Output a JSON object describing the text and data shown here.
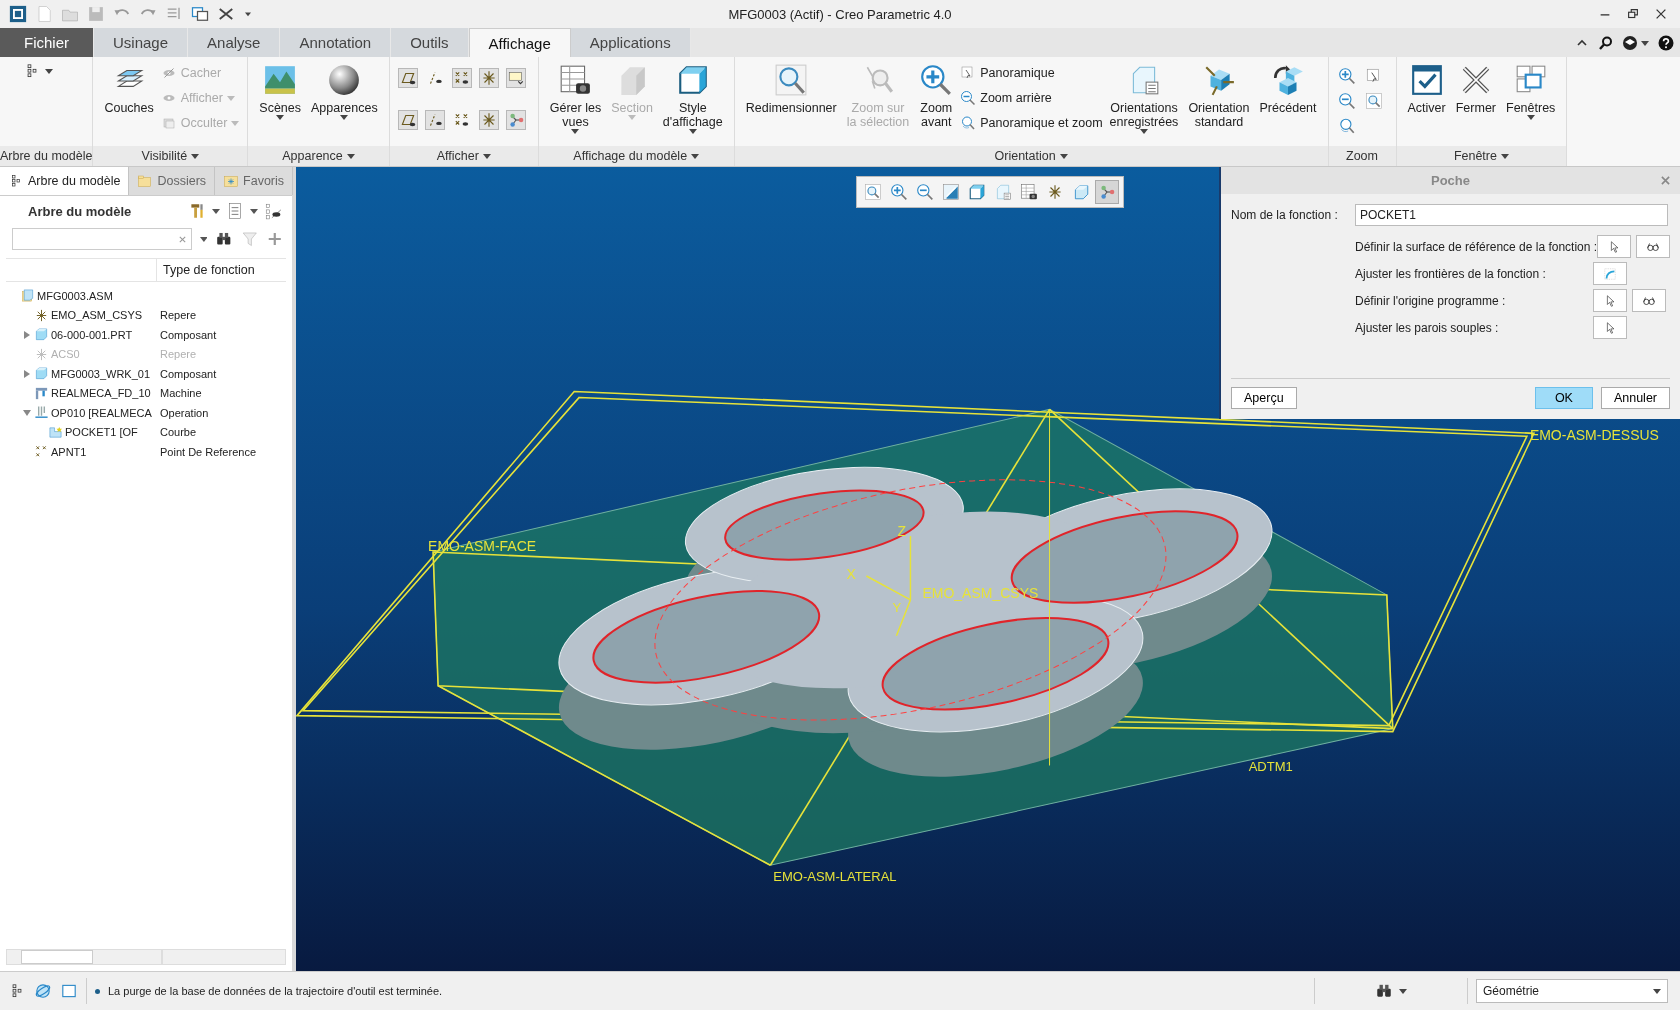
{
  "window": {
    "title": "MFG0003 (Actif) - Creo Parametric 4.0"
  },
  "tabs": [
    {
      "label": "Fichier",
      "kind": "file",
      "selected": false
    },
    {
      "label": "Usinage",
      "kind": "tab",
      "selected": false
    },
    {
      "label": "Analyse",
      "kind": "tab",
      "selected": false
    },
    {
      "label": "Annotation",
      "kind": "tab",
      "selected": false
    },
    {
      "label": "Outils",
      "kind": "tab",
      "selected": false
    },
    {
      "label": "Affichage",
      "kind": "tab",
      "selected": true
    },
    {
      "label": "Applications",
      "kind": "tab",
      "selected": false
    }
  ],
  "ribbon_groups": [
    {
      "label": "Arbre du modèle",
      "menu": false,
      "commands": [
        {
          "kind": "icon",
          "menu": true,
          "on": false
        }
      ]
    },
    {
      "label": "Visibilité",
      "menu": true,
      "commands": [
        {
          "kind": "large",
          "label": "Couches",
          "disabled": false,
          "menu": false
        },
        {
          "kind": "small",
          "label": "Cacher",
          "disabled": true,
          "menu": false
        },
        {
          "kind": "small",
          "label": "Afficher",
          "disabled": true,
          "menu": true
        },
        {
          "kind": "small",
          "label": "Occulter",
          "disabled": true,
          "menu": true
        }
      ]
    },
    {
      "label": "Apparence",
      "menu": true,
      "commands": [
        {
          "kind": "large",
          "label": "Scènes",
          "disabled": false,
          "menu": true
        },
        {
          "kind": "large",
          "label": "Apparences",
          "disabled": false,
          "menu": true
        }
      ]
    },
    {
      "label": "Afficher",
      "menu": true,
      "commands": [
        {
          "kind": "icon",
          "menu": false,
          "on": true
        },
        {
          "kind": "icon",
          "menu": false,
          "on": false
        },
        {
          "kind": "icon",
          "menu": false,
          "on": true
        },
        {
          "kind": "icon",
          "menu": false,
          "on": true
        },
        {
          "kind": "icon",
          "menu": false,
          "on": true
        },
        {
          "kind": "icon",
          "menu": false,
          "on": true
        },
        {
          "kind": "icon",
          "menu": false,
          "on": true
        },
        {
          "kind": "icon",
          "menu": false,
          "on": false
        },
        {
          "kind": "icon",
          "menu": false,
          "on": true
        },
        {
          "kind": "icon",
          "menu": false,
          "on": true
        }
      ]
    },
    {
      "label": "Affichage du modèle",
      "menu": true,
      "commands": [
        {
          "kind": "large",
          "label": "Gérer les\nvues",
          "disabled": false,
          "menu": true
        },
        {
          "kind": "large",
          "label": "Section",
          "disabled": true,
          "menu": true
        },
        {
          "kind": "large",
          "label": "Style\nd'affichage",
          "disabled": false,
          "menu": true
        }
      ]
    },
    {
      "label": "Orientation",
      "menu": true,
      "commands": [
        {
          "kind": "large",
          "label": "Redimensionner",
          "disabled": false,
          "menu": false
        },
        {
          "kind": "large",
          "label": "Zoom sur\nla sélection",
          "disabled": true,
          "menu": false
        },
        {
          "kind": "large",
          "label": "Zoom\navant",
          "disabled": false,
          "menu": false
        },
        {
          "kind": "small",
          "label": "Panoramique",
          "disabled": false,
          "menu": false
        },
        {
          "kind": "small",
          "label": "Zoom arrière",
          "disabled": false,
          "menu": false
        },
        {
          "kind": "small",
          "label": "Panoramique et zoom",
          "disabled": false,
          "menu": false
        },
        {
          "kind": "large",
          "label": "Orientations\nenregistrées",
          "disabled": false,
          "menu": true
        },
        {
          "kind": "large",
          "label": "Orientation\nstandard",
          "disabled": false,
          "menu": false
        },
        {
          "kind": "large",
          "label": "Précédent",
          "disabled": false,
          "menu": false
        }
      ]
    },
    {
      "label": "Zoom",
      "menu": false,
      "commands": [
        {
          "kind": "icon",
          "menu": false,
          "on": false
        },
        {
          "kind": "icon",
          "menu": false,
          "on": false
        },
        {
          "kind": "icon",
          "menu": false,
          "on": false
        },
        {
          "kind": "icon",
          "menu": false,
          "on": false
        },
        {
          "kind": "icon",
          "menu": false,
          "on": false
        }
      ]
    },
    {
      "label": "Fenêtre",
      "menu": true,
      "commands": [
        {
          "kind": "large",
          "label": "Activer",
          "disabled": false,
          "menu": false
        },
        {
          "kind": "large",
          "label": "Fermer",
          "disabled": false,
          "menu": false
        },
        {
          "kind": "large",
          "label": "Fenêtres",
          "disabled": false,
          "menu": true
        }
      ]
    }
  ],
  "panel": {
    "tabs": [
      {
        "label": "Arbre du modèle",
        "selected": true
      },
      {
        "label": "Dossiers",
        "selected": false
      },
      {
        "label": "Favoris",
        "selected": false
      }
    ],
    "heading": "Arbre du modèle",
    "column_header": "Type de fonction",
    "tree": [
      {
        "name": "MFG0003.ASM",
        "disabled": false,
        "children": [
          {
            "name": "EMO_ASM_CSYS",
            "type": "Repere",
            "disabled": false
          },
          {
            "name": "06-000-001.PRT",
            "type": "Composant",
            "disabled": false,
            "expanded": false
          },
          {
            "name": "ACS0",
            "type": "Repere",
            "disabled": true
          },
          {
            "name": "MFG0003_WRK_01",
            "type": "Composant",
            "disabled": false,
            "expanded": false
          },
          {
            "name": "REALMECA_FD_10",
            "type": "Machine",
            "disabled": false
          },
          {
            "name": "OP010 [REALMECA",
            "type": "Operation",
            "disabled": false,
            "expanded": true,
            "children": [
              {
                "name": "POCKET1 [OF",
                "type": "Courbe",
                "disabled": false
              }
            ]
          },
          {
            "name": "APNT1",
            "type": "Point De Reference",
            "disabled": false
          }
        ]
      }
    ]
  },
  "view_toolbar": [
    {
      "on": false
    },
    {
      "on": false
    },
    {
      "on": false
    },
    {
      "on": false
    },
    {
      "on": false
    },
    {
      "on": false
    },
    {
      "on": false
    },
    {
      "on": false
    },
    {
      "on": false
    },
    {
      "on": true
    }
  ],
  "datum_labels": [
    {
      "text": "EMO-ASM-DESSUS"
    },
    {
      "text": "EMO-ASM-FACE"
    },
    {
      "text": "Z"
    },
    {
      "text": "X"
    },
    {
      "text": "EMO_ASM_CSYS"
    },
    {
      "text": "Y"
    },
    {
      "text": "ADTM1"
    },
    {
      "text": "EMO-ASM-LATERAL"
    }
  ],
  "dialog": {
    "title": "Poche",
    "name_label": "Nom de la fonction :",
    "name_value": "POCKET1",
    "rows": [
      {
        "label": "Définir la surface de référence de la fonction :",
        "buttons": [
          {
            "kind": "select"
          },
          {
            "kind": "show"
          }
        ]
      },
      {
        "label": "Ajuster les frontières de la fonction :",
        "buttons": [
          {
            "kind": "boundary"
          }
        ]
      },
      {
        "label": "Définir l'origine programme :",
        "buttons": [
          {
            "kind": "select"
          },
          {
            "kind": "show"
          }
        ]
      },
      {
        "label": "Ajuster les parois souples :",
        "buttons": [
          {
            "kind": "select"
          }
        ]
      }
    ],
    "buttons": [
      {
        "label": "Aperçu",
        "kind": "secondary"
      },
      {
        "label": "OK",
        "kind": "primary"
      },
      {
        "label": "Annuler",
        "kind": "secondary"
      }
    ]
  },
  "status_bar": {
    "message": "La purge de la base de données de la trajectoire d'outil est terminée.",
    "filter_value": "Géométrie"
  }
}
